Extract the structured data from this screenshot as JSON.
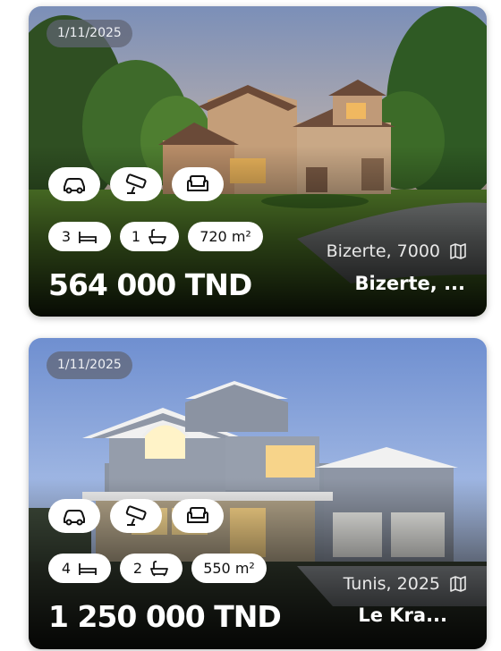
{
  "listings": [
    {
      "date": "1/11/2025",
      "bedrooms": "3",
      "bathrooms": "1",
      "area": "720 m²",
      "location": "Bizerte, 7000",
      "price": "564 000 TND",
      "title": "Bizerte, ..."
    },
    {
      "date": "1/11/2025",
      "bedrooms": "4",
      "bathrooms": "2",
      "area": "550 m²",
      "location": "Tunis, 2025",
      "price": "1 250 000 TND",
      "title": "Le Kra..."
    }
  ],
  "amenities": [
    "car-icon",
    "security-camera-icon",
    "sofa-icon"
  ],
  "icons": {
    "bed": "bed-icon",
    "bath": "bathtub-icon",
    "location": "map-icon"
  }
}
